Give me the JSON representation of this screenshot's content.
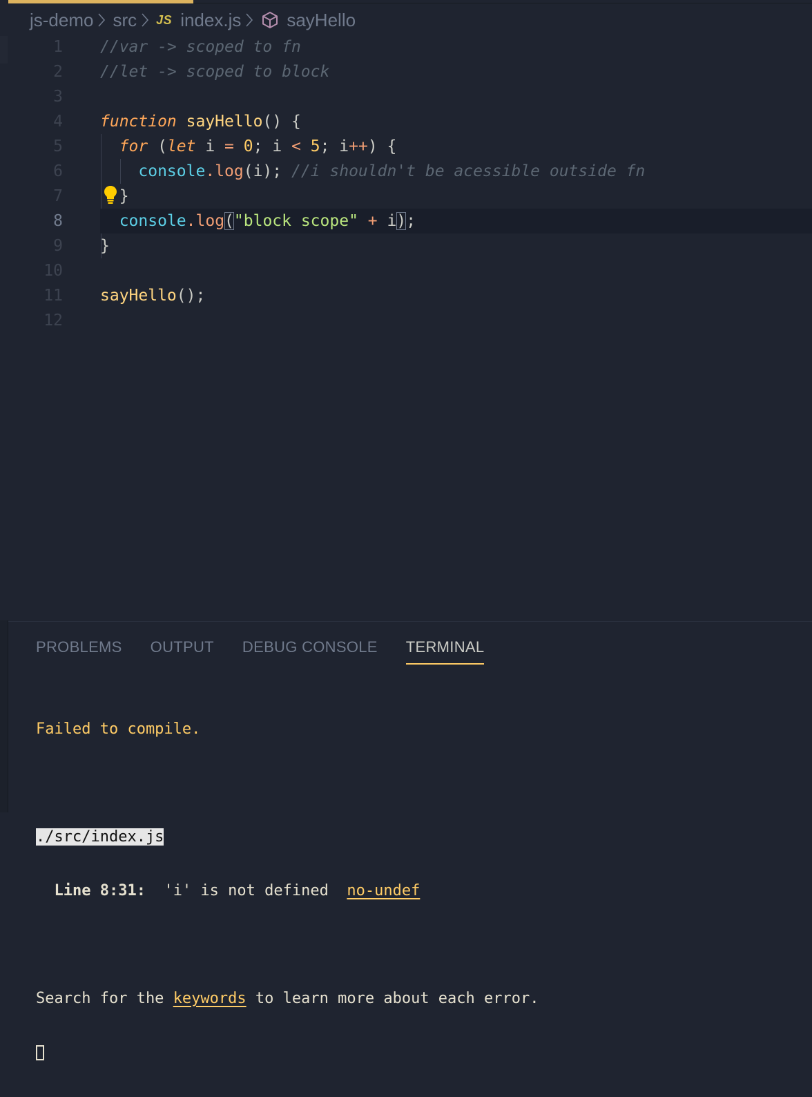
{
  "breadcrumb": {
    "folder": "js-demo",
    "subfolder": "src",
    "file_badge": "JS",
    "file": "index.js",
    "symbol": "sayHello"
  },
  "editor": {
    "line_numbers": [
      "1",
      "2",
      "3",
      "4",
      "5",
      "6",
      "7",
      "8",
      "9",
      "10",
      "11",
      "12"
    ],
    "code": {
      "l1": "//var -> scoped to fn",
      "l2": "//let -> scoped to block",
      "l4_kw": "function",
      "l4_fn": "sayHello",
      "l4_rest": "() {",
      "l5_kw_for": "for",
      "l5_p1": " (",
      "l5_kw_let": "let",
      "l5_p2": " i ",
      "l5_eq": "=",
      "l5_p3": " ",
      "l5_zero": "0",
      "l5_p4": "; i ",
      "l5_lt": "<",
      "l5_p5": " ",
      "l5_five": "5",
      "l5_p6": "; i",
      "l5_inc": "++",
      "l5_p7": ") {",
      "l6_obj": "console",
      "l6_dot": ".",
      "l6_prop": "log",
      "l6_args": "(i); ",
      "l6_cmt": "//i shouldn't be acessible outside fn",
      "l7": "}",
      "l8_obj": "console",
      "l8_dot": ".",
      "l8_prop": "log",
      "l8_open": "(",
      "l8_str": "\"block scope\"",
      "l8_sp": " ",
      "l8_plus": "+",
      "l8_var": " i",
      "l8_close": ")",
      "l8_semi": ";",
      "l9": "}",
      "l11_fn": "sayHello",
      "l11_rest": "();"
    }
  },
  "panel": {
    "tabs": [
      "PROBLEMS",
      "OUTPUT",
      "DEBUG CONSOLE",
      "TERMINAL"
    ],
    "active_tab": "TERMINAL"
  },
  "terminal": {
    "failed": "Failed to compile.",
    "path": "./src/index.js",
    "line_label": "  Line 8:31:",
    "error_msg": "  'i' is not defined  ",
    "rule": "no-undef",
    "search_pre": "Search for the ",
    "search_link": "keywords",
    "search_post": " to learn more about each error."
  },
  "colors": {
    "background": "#1f2430",
    "accent": "#ffcc66",
    "keyword": "#ffa759",
    "string": "#bae67e",
    "entity": "#5ccfe6"
  },
  "icons": {
    "symbol": "cube-icon",
    "lightbulb": "lightbulb-icon"
  }
}
